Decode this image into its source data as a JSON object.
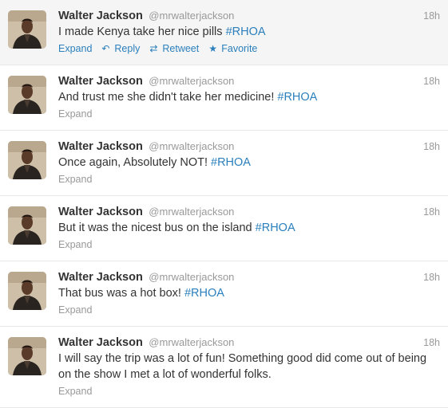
{
  "tweets": [
    {
      "name": "Walter Jackson",
      "handle": "@mrwalterjackson",
      "time": "18h",
      "text": "I made Kenya take her nice pills ",
      "hashtag": "#RHOA",
      "hovered": true
    },
    {
      "name": "Walter Jackson",
      "handle": "@mrwalterjackson",
      "time": "18h",
      "text": "And trust me she didn't take her medicine! ",
      "hashtag": "#RHOA",
      "hovered": false
    },
    {
      "name": "Walter Jackson",
      "handle": "@mrwalterjackson",
      "time": "18h",
      "text": "Once again, Absolutely NOT! ",
      "hashtag": "#RHOA",
      "hovered": false
    },
    {
      "name": "Walter Jackson",
      "handle": "@mrwalterjackson",
      "time": "18h",
      "text": "But it was the nicest bus on the island ",
      "hashtag": "#RHOA",
      "hovered": false
    },
    {
      "name": "Walter Jackson",
      "handle": "@mrwalterjackson",
      "time": "18h",
      "text": "That bus was a hot box! ",
      "hashtag": "#RHOA",
      "hovered": false
    },
    {
      "name": "Walter Jackson",
      "handle": "@mrwalterjackson",
      "time": "18h",
      "text": "I will say the trip was a lot of fun! Something good did come out of being on the show I met a lot of wonderful folks.",
      "hashtag": "",
      "hovered": false
    }
  ],
  "actions": {
    "expand": "Expand",
    "reply": "Reply",
    "retweet": "Retweet",
    "favorite": "Favorite"
  },
  "icons": {
    "reply": "reply-arrow-icon",
    "retweet": "retweet-arrows-icon",
    "favorite": "star-icon"
  },
  "colors": {
    "link": "#2a7fbc",
    "muted": "#999999",
    "hover_bg": "#f5f5f5"
  }
}
